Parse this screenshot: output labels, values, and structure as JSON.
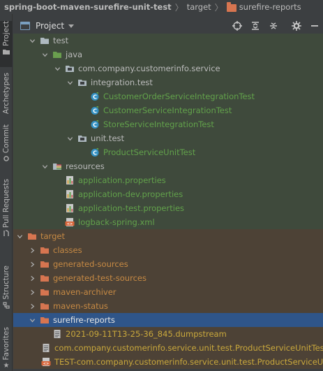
{
  "breadcrumb": {
    "project": "spring-boot-maven-surefire-unit-test",
    "folder": "target",
    "current": "surefire-reports"
  },
  "tool_stripe": {
    "project": "Project",
    "archetypes": "Archetypes",
    "commit": "Commit",
    "pull_requests": "Pull Requests",
    "structure": "Structure",
    "favorites": "Favorites"
  },
  "panel": {
    "view_label": "Project",
    "buttons": [
      "locate-icon",
      "expand-all-icon",
      "collapse-all-icon",
      "settings-icon",
      "hide-icon"
    ]
  },
  "tree": [
    {
      "label": "test",
      "indent": 2,
      "expanded": true,
      "icon": "folder",
      "color": "default",
      "bg": "green"
    },
    {
      "label": "java",
      "indent": 3,
      "expanded": true,
      "icon": "test-source-folder",
      "color": "default",
      "bg": "green"
    },
    {
      "label": "com.company.customerinfo.service",
      "indent": 4,
      "expanded": true,
      "icon": "package",
      "color": "default",
      "bg": "green"
    },
    {
      "label": "integration.test",
      "indent": 5,
      "expanded": true,
      "icon": "package",
      "color": "default",
      "bg": "green"
    },
    {
      "label": "CustomerOrderServiceIntegrationTest",
      "indent": 6,
      "expanded": null,
      "icon": "test-class",
      "color": "green",
      "bg": "green"
    },
    {
      "label": "CustomerServiceIntegrationTest",
      "indent": 6,
      "expanded": null,
      "icon": "test-class",
      "color": "green",
      "bg": "green"
    },
    {
      "label": "StoreServiceIntegrationTest",
      "indent": 6,
      "expanded": null,
      "icon": "test-class",
      "color": "green",
      "bg": "green"
    },
    {
      "label": "unit.test",
      "indent": 5,
      "expanded": true,
      "icon": "package",
      "color": "default",
      "bg": "green"
    },
    {
      "label": "ProductServiceUnitTest",
      "indent": 6,
      "expanded": null,
      "icon": "test-class",
      "color": "green",
      "bg": "green"
    },
    {
      "label": "resources",
      "indent": 3,
      "expanded": true,
      "icon": "test-resources-folder",
      "color": "default",
      "bg": "green"
    },
    {
      "label": "application.properties",
      "indent": 4,
      "expanded": null,
      "icon": "properties-file",
      "color": "green",
      "bg": "green"
    },
    {
      "label": "application-dev.properties",
      "indent": 4,
      "expanded": null,
      "icon": "properties-file",
      "color": "green",
      "bg": "green"
    },
    {
      "label": "application-test.properties",
      "indent": 4,
      "expanded": null,
      "icon": "properties-file",
      "color": "green",
      "bg": "green"
    },
    {
      "label": "logback-spring.xml",
      "indent": 4,
      "expanded": null,
      "icon": "xml-file",
      "color": "green",
      "bg": "green"
    },
    {
      "label": "target",
      "indent": 1,
      "expanded": true,
      "icon": "excluded-folder",
      "color": "orange",
      "bg": "brown"
    },
    {
      "label": "classes",
      "indent": 2,
      "expanded": false,
      "icon": "excluded-folder",
      "color": "orange",
      "bg": "brown"
    },
    {
      "label": "generated-sources",
      "indent": 2,
      "expanded": false,
      "icon": "excluded-folder",
      "color": "orange",
      "bg": "brown"
    },
    {
      "label": "generated-test-sources",
      "indent": 2,
      "expanded": false,
      "icon": "excluded-folder",
      "color": "orange",
      "bg": "brown"
    },
    {
      "label": "maven-archiver",
      "indent": 2,
      "expanded": false,
      "icon": "excluded-folder",
      "color": "orange",
      "bg": "brown"
    },
    {
      "label": "maven-status",
      "indent": 2,
      "expanded": false,
      "icon": "excluded-folder",
      "color": "orange",
      "bg": "brown"
    },
    {
      "label": "surefire-reports",
      "indent": 2,
      "expanded": true,
      "icon": "excluded-folder",
      "color": "white",
      "bg": "selected"
    },
    {
      "label": "2021-09-11T13-25-36_845.dumpstream",
      "indent": 3,
      "expanded": null,
      "icon": "text-file",
      "color": "yellow",
      "bg": "brown"
    },
    {
      "label": "com.company.customerinfo.service.unit.test.ProductServiceUnitTest.txt",
      "indent": 3,
      "expanded": null,
      "icon": "text-file",
      "color": "yellow",
      "bg": "brown"
    },
    {
      "label": "TEST-com.company.customerinfo.service.unit.test.ProductServiceUnitTest.xml",
      "indent": 3,
      "expanded": null,
      "icon": "xml-file",
      "color": "yellow",
      "bg": "brown"
    }
  ],
  "colors": {
    "background": "#3c3f41",
    "selection": "#2f5589",
    "test_scope_bg": "#3f4a3c",
    "excluded_bg": "#4d4236",
    "test_green": "#62a24b",
    "excluded_orange": "#d77550"
  }
}
